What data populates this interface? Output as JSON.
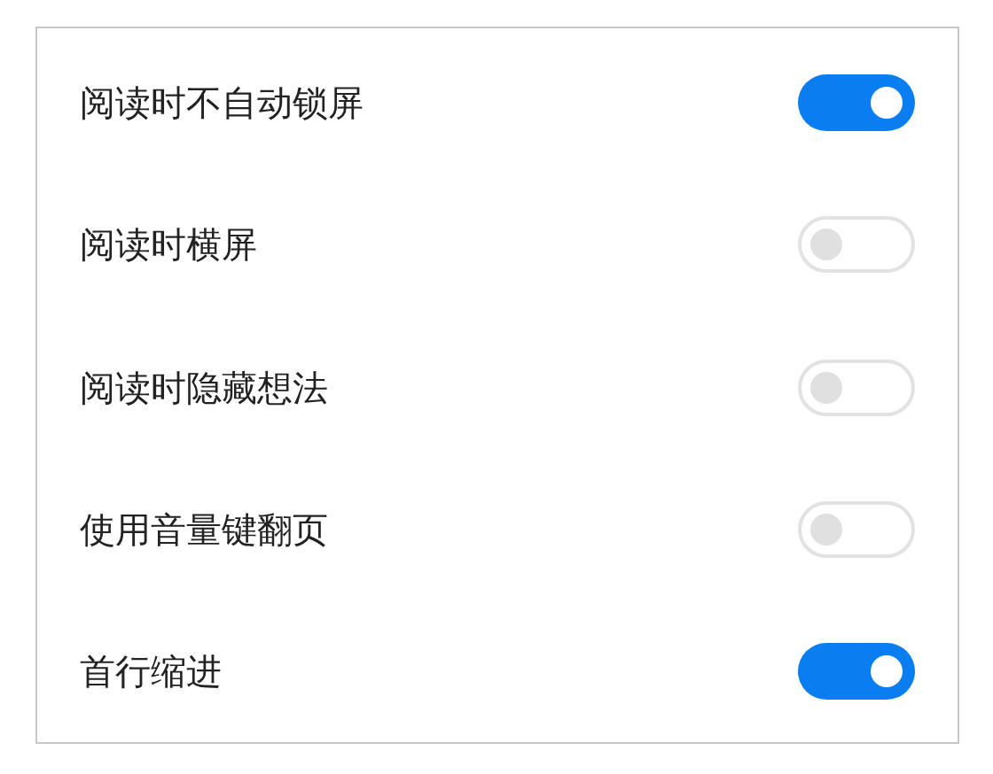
{
  "settings": [
    {
      "label": "阅读时不自动锁屏",
      "on": true
    },
    {
      "label": "阅读时横屏",
      "on": false
    },
    {
      "label": "阅读时隐藏想法",
      "on": false
    },
    {
      "label": "使用音量键翻页",
      "on": false
    },
    {
      "label": "首行缩进",
      "on": true
    }
  ]
}
